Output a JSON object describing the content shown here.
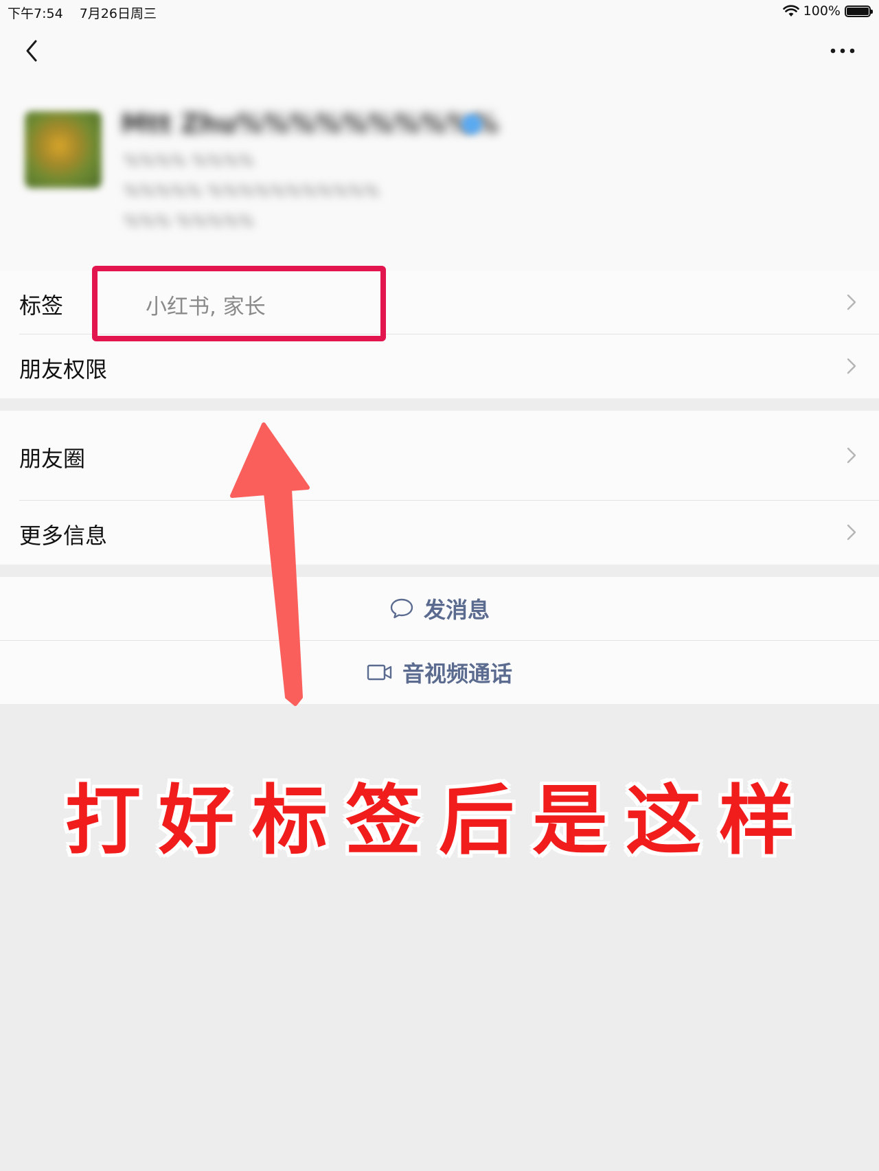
{
  "status_bar": {
    "time": "下午7:54",
    "date": "7月26日周三",
    "battery_text": "100%",
    "battery_level": 1.0
  },
  "nav": {
    "back_icon": "chevron-left-icon",
    "more_icon": "ellipsis-icon"
  },
  "profile": {
    "name_blurred": "Mtt Zhu%%%%%%%%%%",
    "meta": [
      "%%%%  %%%%",
      "%%%%%  %%%%%%%%%%%",
      "%%%  %%%%%"
    ]
  },
  "rows": {
    "tags_label": "标签",
    "tags_value": "小红书, 家长",
    "permissions_label": "朋友权限",
    "moments_label": "朋友圈",
    "more_info_label": "更多信息"
  },
  "actions": {
    "message_label": "发消息",
    "message_icon": "chat-bubble-icon",
    "call_label": "音视频通话",
    "call_icon": "video-camera-icon"
  },
  "annotation": {
    "caption": "打好标签后是这样",
    "arrow_color": "#fa5f5c",
    "highlight_color": "#e3154f"
  }
}
